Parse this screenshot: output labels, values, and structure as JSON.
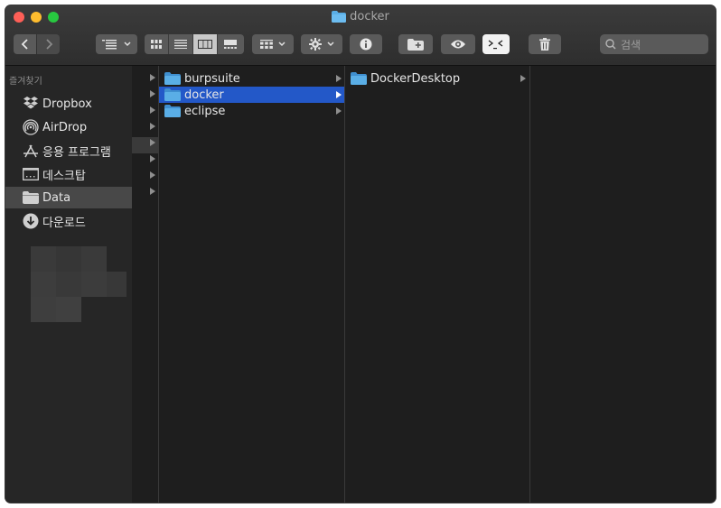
{
  "window": {
    "title": "docker",
    "title_icon": "folder-icon"
  },
  "toolbar": {
    "back_icon": "chevron-left-icon",
    "forward_icon": "chevron-right-icon",
    "group_icon": "list-group-icon",
    "view_modes": [
      "icon-view",
      "list-view",
      "column-view",
      "gallery-view"
    ],
    "active_view": "column-view",
    "arrange_icon": "grid-arrange-icon",
    "action_icon": "gear-icon",
    "info_icon": "info-icon",
    "new_folder_icon": "new-folder-icon",
    "quicklook_icon": "eye-icon",
    "terminal_icon": "terminal-icon",
    "trash_icon": "trash-icon",
    "search_placeholder": "검색"
  },
  "sidebar": {
    "section_title": "즐겨찾기",
    "items": [
      {
        "label": "Dropbox",
        "icon": "dropbox-icon"
      },
      {
        "label": "AirDrop",
        "icon": "airdrop-icon"
      },
      {
        "label": "응용 프로그램",
        "icon": "applications-icon"
      },
      {
        "label": "데스크탑",
        "icon": "desktop-icon"
      },
      {
        "label": "Data",
        "icon": "folder-icon",
        "selected": true
      },
      {
        "label": "다운로드",
        "icon": "download-icon"
      }
    ]
  },
  "columns": {
    "col1": [
      {
        "label": "burpsuite",
        "selected": false
      },
      {
        "label": "docker",
        "selected": true
      },
      {
        "label": "eclipse",
        "selected": false
      }
    ],
    "col2": [
      {
        "label": "DockerDesktop",
        "selected": false
      }
    ]
  },
  "colors": {
    "selection": "#2358c8",
    "folder": "#5aaee6",
    "window_bg": "#1e1e1e",
    "sidebar_bg": "#262626"
  }
}
